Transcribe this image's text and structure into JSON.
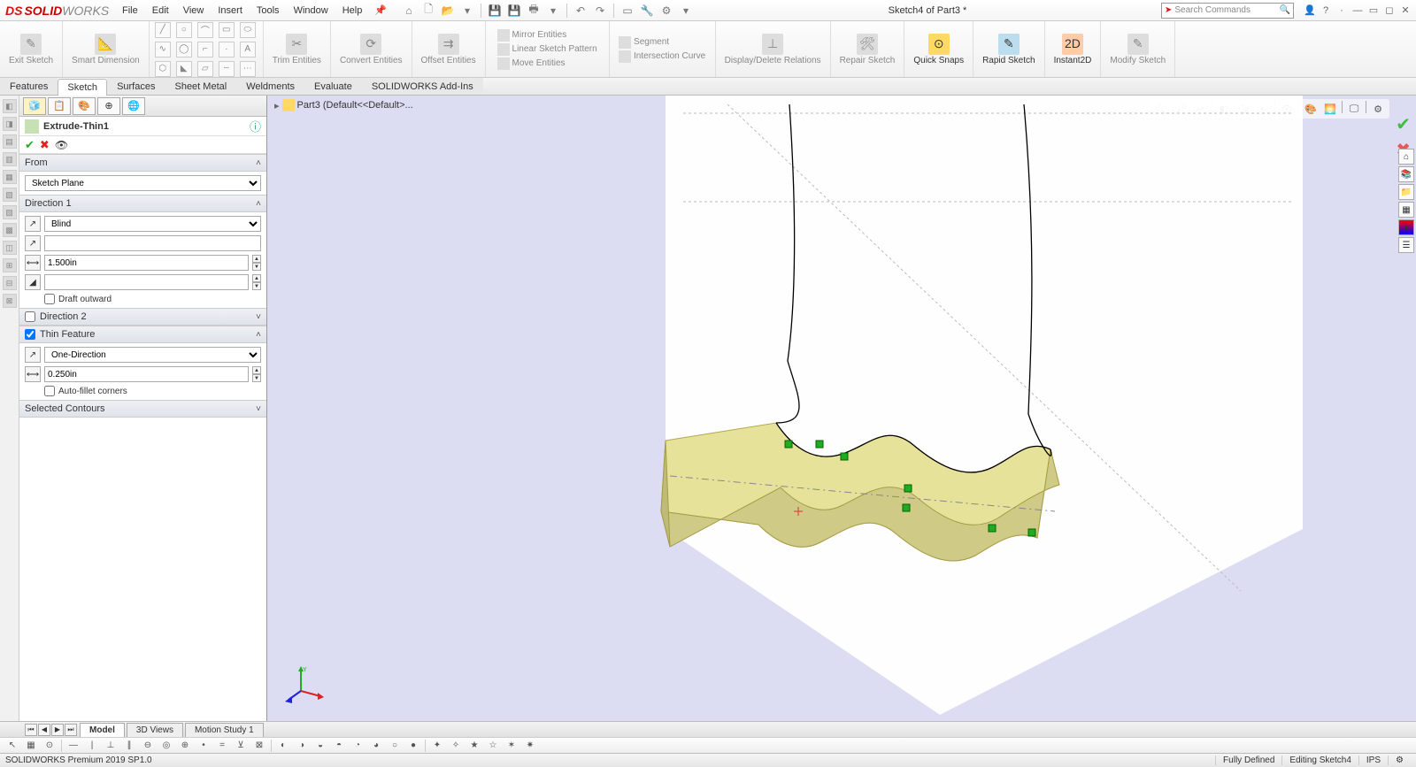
{
  "app": {
    "name_solid": "SOLID",
    "name_works": "WORKS",
    "ds": "DS"
  },
  "menu": [
    "File",
    "Edit",
    "View",
    "Insert",
    "Tools",
    "Window",
    "Help"
  ],
  "doc_title": "Sketch4 of Part3 *",
  "search_placeholder": "Search Commands",
  "ribbon": {
    "exit_sketch": "Exit\nSketch",
    "smart_dim": "Smart\nDimension",
    "trim": "Trim\nEntities",
    "convert": "Convert\nEntities",
    "offset": "Offset\nEntities",
    "mirror": "Mirror Entities",
    "pattern": "Linear Sketch Pattern",
    "move": "Move Entities",
    "segment": "Segment",
    "intersection": "Intersection Curve",
    "display": "Display/Delete\nRelations",
    "repair": "Repair\nSketch",
    "quick_snaps": "Quick\nSnaps",
    "rapid": "Rapid\nSketch",
    "instant2d": "Instant2D",
    "modify": "Modify\nSketch"
  },
  "cm_tabs": [
    "Features",
    "Sketch",
    "Surfaces",
    "Sheet Metal",
    "Weldments",
    "Evaluate",
    "SOLIDWORKS Add-Ins"
  ],
  "cm_active": 1,
  "breadcrumb": "Part3  (Default<<Default>...",
  "pm": {
    "title": "Extrude-Thin1",
    "from_h": "From",
    "from_val": "Sketch Plane",
    "dir1_h": "Direction 1",
    "dir1_type": "Blind",
    "dir1_depth": "1.500in",
    "draft_out": "Draft outward",
    "dir2_h": "Direction 2",
    "thin_h": "Thin Feature",
    "thin_type": "One-Direction",
    "thin_thk": "0.250in",
    "autofillet": "Auto-fillet corners",
    "contours_h": "Selected Contours"
  },
  "motion_tabs": [
    "Model",
    "3D Views",
    "Motion Study 1"
  ],
  "status": {
    "product": "SOLIDWORKS Premium 2019 SP1.0",
    "fully_defined": "Fully Defined",
    "editing": "Editing Sketch4",
    "units": "IPS"
  }
}
